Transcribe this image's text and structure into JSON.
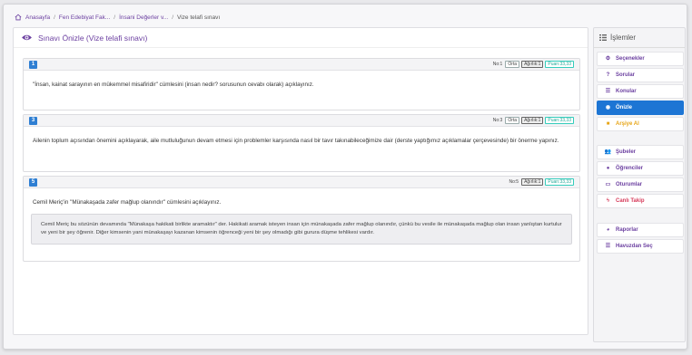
{
  "breadcrumb": {
    "items": [
      "Anasayfa",
      "Fen Edebiyat Fak...",
      "İnsani Değerler v...",
      "Vize telafi sınavı"
    ],
    "sep": "/"
  },
  "main": {
    "title": "Sınavı Önizle (Vize telafi sınavı)"
  },
  "questions": [
    {
      "num": "1",
      "no_label": "No:1",
      "level": "Orta",
      "weight": "Ağırlık:1",
      "score": "Puan:33,33",
      "text": "\"İnsan, kainat sarayının en mükemmel misafiridir\" cümlesini (insan nedir? sorusunun cevabı olarak) açıklayınız."
    },
    {
      "num": "3",
      "no_label": "No:3",
      "level": "Orta",
      "weight": "Ağırlık:1",
      "score": "Puan:33,33",
      "text": "Ailenin toplum açısından önemini açıklayarak, aile mutluluğunun devam etmesi için problemler karşısında nasıl bir tavır takınabileceğimize dair (derste yaptığımız açıklamalar çerçevesinde) bir önerme yapınız."
    },
    {
      "num": "5",
      "no_label": "No:5",
      "weight": "Ağırlık:1",
      "score": "Puan:33,33",
      "text": "Cemil Meriç'in \"Münakaşada zafer mağlup olanındır\" cümlesini açıklayınız.",
      "answer": "Cemil Meriç bu sözünün devamında \"Münakaşa hakikati birlikte aramaktır\" der. Hakikati aramak isteyen insan için münakaşada zafer mağlup olanındır, çünkü bu vesile ile münakaşada mağlup olan insan yanlıştan kurtulur ve yeni bir şey öğrenir. Diğer kimsenin yani münakaşayı kazanan kimsenin öğrenceği yeni bir şey olmadığı gibi gurura düşme tehlikesi vardır."
    }
  ],
  "sidebar": {
    "title": "İşlemler",
    "items": [
      {
        "label": "Seçenekler",
        "icon": "gear-icon"
      },
      {
        "label": "Sorular",
        "icon": "question-icon"
      },
      {
        "label": "Konular",
        "icon": "list-icon"
      },
      {
        "label": "Önizle",
        "icon": "eye-icon"
      },
      {
        "label": "Arşiye Al",
        "icon": "archive-icon"
      },
      {
        "label": "Şubeler",
        "icon": "group-icon"
      },
      {
        "label": "Öğrenciler",
        "icon": "user-icon"
      },
      {
        "label": "Oturumlar",
        "icon": "monitor-icon"
      },
      {
        "label": "Canlı Takip",
        "icon": "bolt-icon"
      },
      {
        "label": "Raporlar",
        "icon": "chart-icon"
      },
      {
        "label": "Havuzdan Seç",
        "icon": "list-icon"
      }
    ]
  },
  "colors": {
    "accent": "#6b3fa0",
    "active": "#1d75d4",
    "badge": "#2f7fd3",
    "warn": "#e7a516"
  }
}
